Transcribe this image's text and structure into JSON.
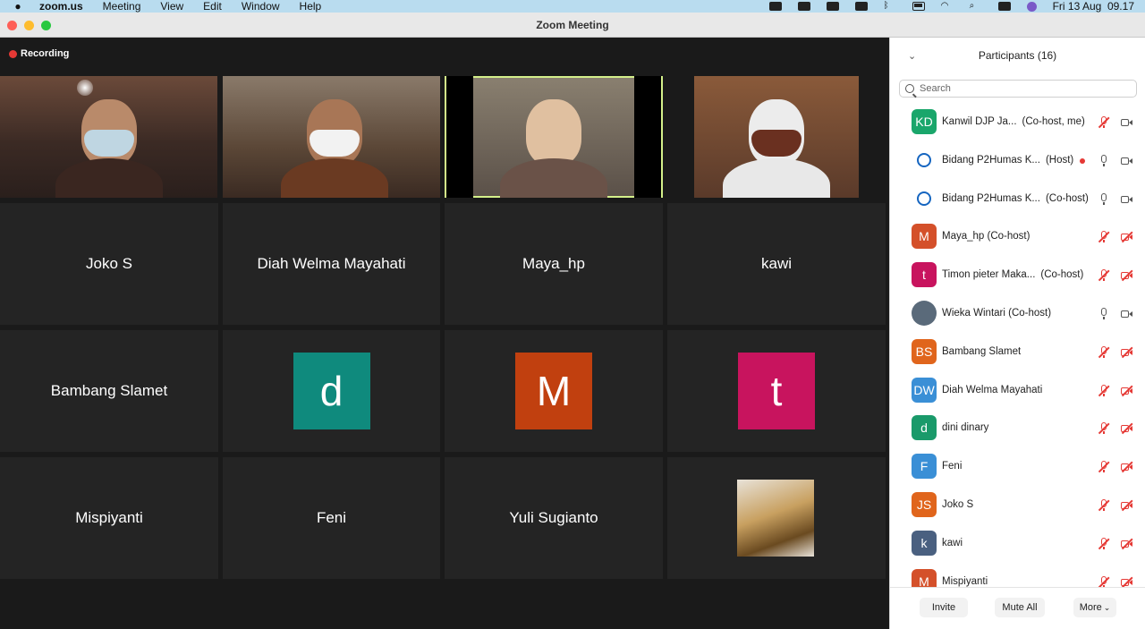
{
  "menubar": {
    "app": "zoom.us",
    "items": [
      "Meeting",
      "View",
      "Edit",
      "Window",
      "Help"
    ],
    "clock": "Fri 13 Aug  09.17"
  },
  "window": {
    "title": "Zoom Meeting"
  },
  "recording": "Recording",
  "tiles": [
    {
      "name": "Joko S"
    },
    {
      "name": "Diah Welma Mayahati"
    },
    {
      "name": "Maya_hp"
    },
    {
      "name": "kawi"
    },
    {
      "name": "Bambang Slamet"
    },
    {
      "avatar": "d",
      "color": "#0f8a7d"
    },
    {
      "avatar": "M",
      "color": "#c1400f"
    },
    {
      "avatar": "t",
      "color": "#c8145e"
    },
    {
      "name": "Mispiyanti"
    },
    {
      "name": "Feni"
    },
    {
      "name": "Yuli Sugianto"
    }
  ],
  "panel": {
    "title": "Participants (16)",
    "search_placeholder": "Search",
    "participants": [
      {
        "initials": "KD",
        "color": "#1aa66b",
        "name": "Kanwil DJP Ja...",
        "role": "(Co-host, me)",
        "mic_muted": true,
        "video_off": false
      },
      {
        "initials": "",
        "name": "Bidang P2Humas K...",
        "role": "(Host)",
        "recording": true,
        "mic_muted": false,
        "video_off": false
      },
      {
        "initials": "",
        "name": "Bidang P2Humas K...",
        "role": "(Co-host)",
        "mic_muted": false,
        "video_off": false
      },
      {
        "initials": "M",
        "color": "#d4502a",
        "name": "Maya_hp (Co-host)",
        "role": "",
        "mic_muted": true,
        "video_off": true
      },
      {
        "initials": "t",
        "color": "#c8145e",
        "name": "Timon pieter Maka...",
        "role": "(Co-host)",
        "mic_muted": true,
        "video_off": true
      },
      {
        "initials": "",
        "color": "#5a6a7a",
        "name": "Wieka Wintari (Co-host)",
        "role": "",
        "mic_muted": false,
        "video_off": false
      },
      {
        "initials": "BS",
        "color": "#e0651c",
        "name": "Bambang Slamet",
        "role": "",
        "mic_muted": true,
        "video_off": true
      },
      {
        "initials": "DW",
        "color": "#3a8fd6",
        "name": "Diah Welma Mayahati",
        "role": "",
        "mic_muted": true,
        "video_off": true
      },
      {
        "initials": "d",
        "color": "#1a9a6a",
        "name": "dini dinary",
        "role": "",
        "mic_muted": true,
        "video_off": true
      },
      {
        "initials": "F",
        "color": "#3a8fd6",
        "name": "Feni",
        "role": "",
        "mic_muted": true,
        "video_off": true
      },
      {
        "initials": "JS",
        "color": "#e0651c",
        "name": "Joko S",
        "role": "",
        "mic_muted": true,
        "video_off": true
      },
      {
        "initials": "k",
        "color": "#4a6080",
        "name": "kawi",
        "role": "",
        "mic_muted": true,
        "video_off": true
      },
      {
        "initials": "M",
        "color": "#d4502a",
        "name": "Mispiyanti",
        "role": "",
        "mic_muted": true,
        "video_off": true
      }
    ],
    "buttons": {
      "invite": "Invite",
      "mute_all": "Mute All",
      "more": "More"
    }
  }
}
